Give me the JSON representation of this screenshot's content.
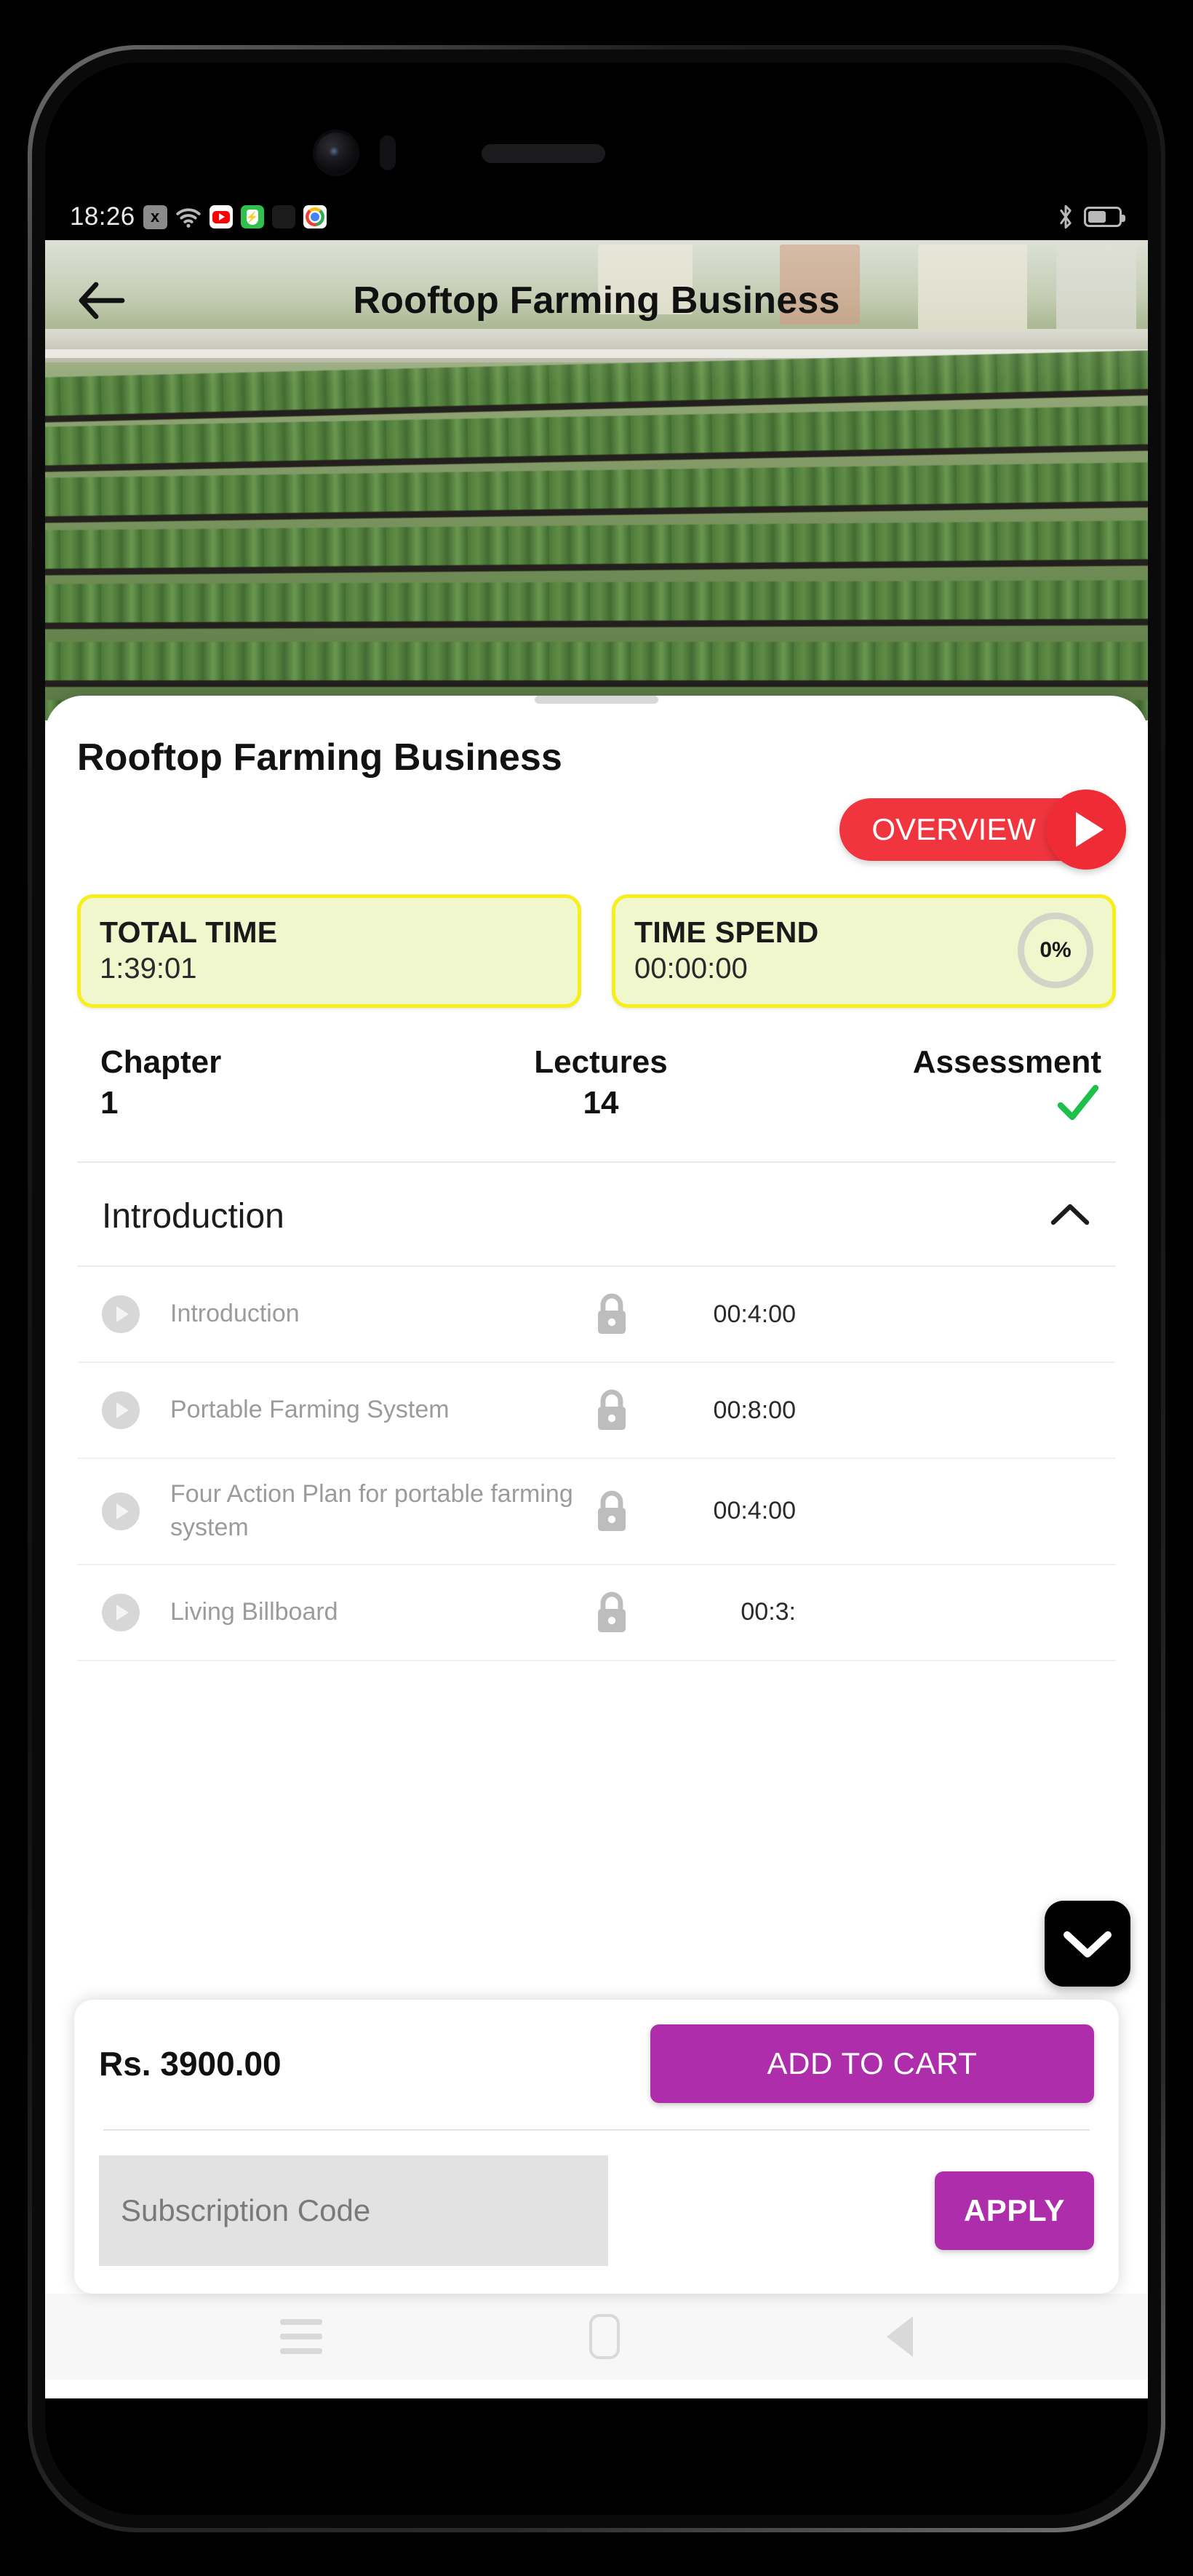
{
  "status_bar": {
    "time": "18:26",
    "left_icons": [
      "close-badge-icon",
      "wifi-icon",
      "youtube-icon",
      "shield-vpn-icon",
      "app-grid-icon",
      "chrome-icon"
    ],
    "right_icons": [
      "bluetooth-icon",
      "battery-icon"
    ]
  },
  "app_bar": {
    "back_icon": "back-arrow-icon",
    "title": "Rooftop Farming Business"
  },
  "course": {
    "title": "Rooftop Farming Business",
    "overview_label": "OVERVIEW",
    "play_icon": "play-icon"
  },
  "time_cards": [
    {
      "label": "TOTAL TIME",
      "value": "1:39:01",
      "percent": null
    },
    {
      "label": "TIME SPEND",
      "value": "00:00:00",
      "percent": "0%"
    }
  ],
  "stats": [
    {
      "label": "Chapter",
      "value": "1"
    },
    {
      "label": "Lectures",
      "value": "14"
    },
    {
      "label": "Assessment",
      "value": "✓"
    }
  ],
  "accordion": {
    "title": "Introduction",
    "chevron_icon": "chevron-up-icon",
    "expanded": true,
    "lectures": [
      {
        "title": "Introduction",
        "duration": "00:4:00",
        "locked": true
      },
      {
        "title": "Portable Farming System",
        "duration": "00:8:00",
        "locked": true
      },
      {
        "title": "Four Action Plan for portable farming system",
        "duration": "00:4:00",
        "locked": true
      },
      {
        "title": "Living Billboard",
        "duration": "00:3:",
        "locked": true
      }
    ]
  },
  "scroll_fab": {
    "icon": "chevron-down-icon"
  },
  "purchase": {
    "price": "Rs. 3900.00",
    "add_to_cart_label": "ADD TO CART",
    "subscription_placeholder": "Subscription Code",
    "subscription_value": "",
    "apply_label": "APPLY"
  },
  "nav_bar": {
    "recents_icon": "recents-icon",
    "home_icon": "home-icon",
    "back_icon": "back-triangle-icon"
  },
  "colors": {
    "accent_red": "#f0353f",
    "accent_purple": "#ad2daa",
    "card_yellow_bg": "#f0f7cd",
    "card_yellow_border": "#f6ef1b",
    "check_green": "#1fbf4b"
  }
}
